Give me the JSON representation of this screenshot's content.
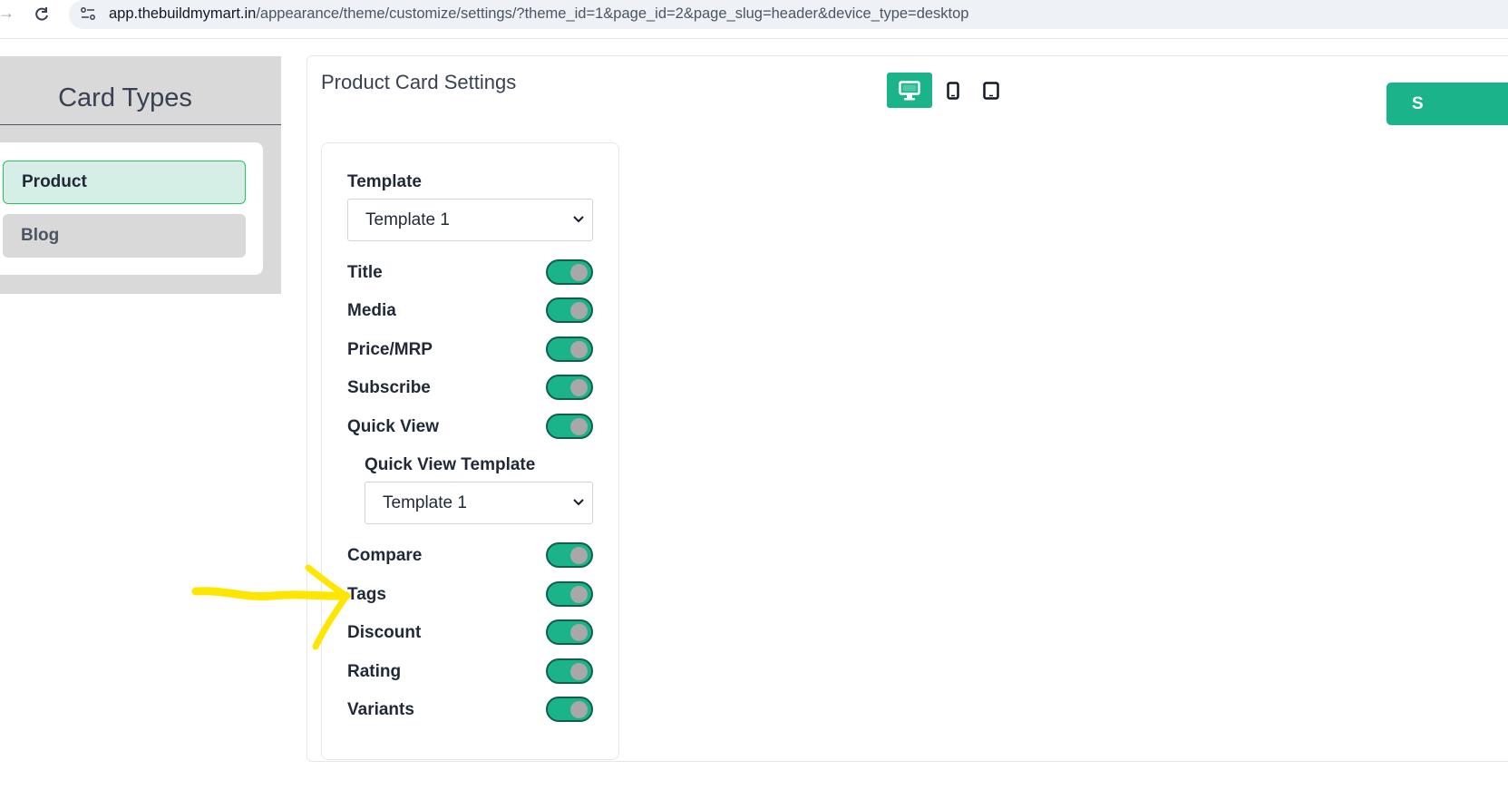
{
  "browser": {
    "url_host": "app.thebuildmymart.in",
    "url_path": "/appearance/theme/customize/settings/?theme_id=1&page_id=2&page_slug=header&device_type=desktop",
    "icons": [
      "forward-arrow-icon",
      "reload-icon",
      "site-settings-icon"
    ]
  },
  "sidebar": {
    "title": "Card Types",
    "items": [
      {
        "label": "Product",
        "active": true
      },
      {
        "label": "Blog",
        "active": false
      }
    ]
  },
  "main": {
    "title": "Product Card Settings",
    "devices": [
      "desktop-icon",
      "mobile-icon",
      "tablet-icon"
    ],
    "active_device": "desktop",
    "save_label": "S",
    "accent_color": "#1bb38a"
  },
  "settings": {
    "template_label": "Template",
    "template_value": "Template 1",
    "toggles": [
      {
        "label": "Title",
        "on": true
      },
      {
        "label": "Media",
        "on": true
      },
      {
        "label": "Price/MRP",
        "on": true
      },
      {
        "label": "Subscribe",
        "on": true
      },
      {
        "label": "Quick View",
        "on": true
      },
      {
        "label": "Compare",
        "on": true
      },
      {
        "label": "Tags",
        "on": true
      },
      {
        "label": "Discount",
        "on": true
      },
      {
        "label": "Rating",
        "on": true
      },
      {
        "label": "Variants",
        "on": true
      }
    ],
    "quick_view_template_label": "Quick View Template",
    "quick_view_template_value": "Template 1"
  },
  "annotation": {
    "type": "yellow-arrow",
    "points_to": "Tags",
    "color": "#ffe600"
  }
}
